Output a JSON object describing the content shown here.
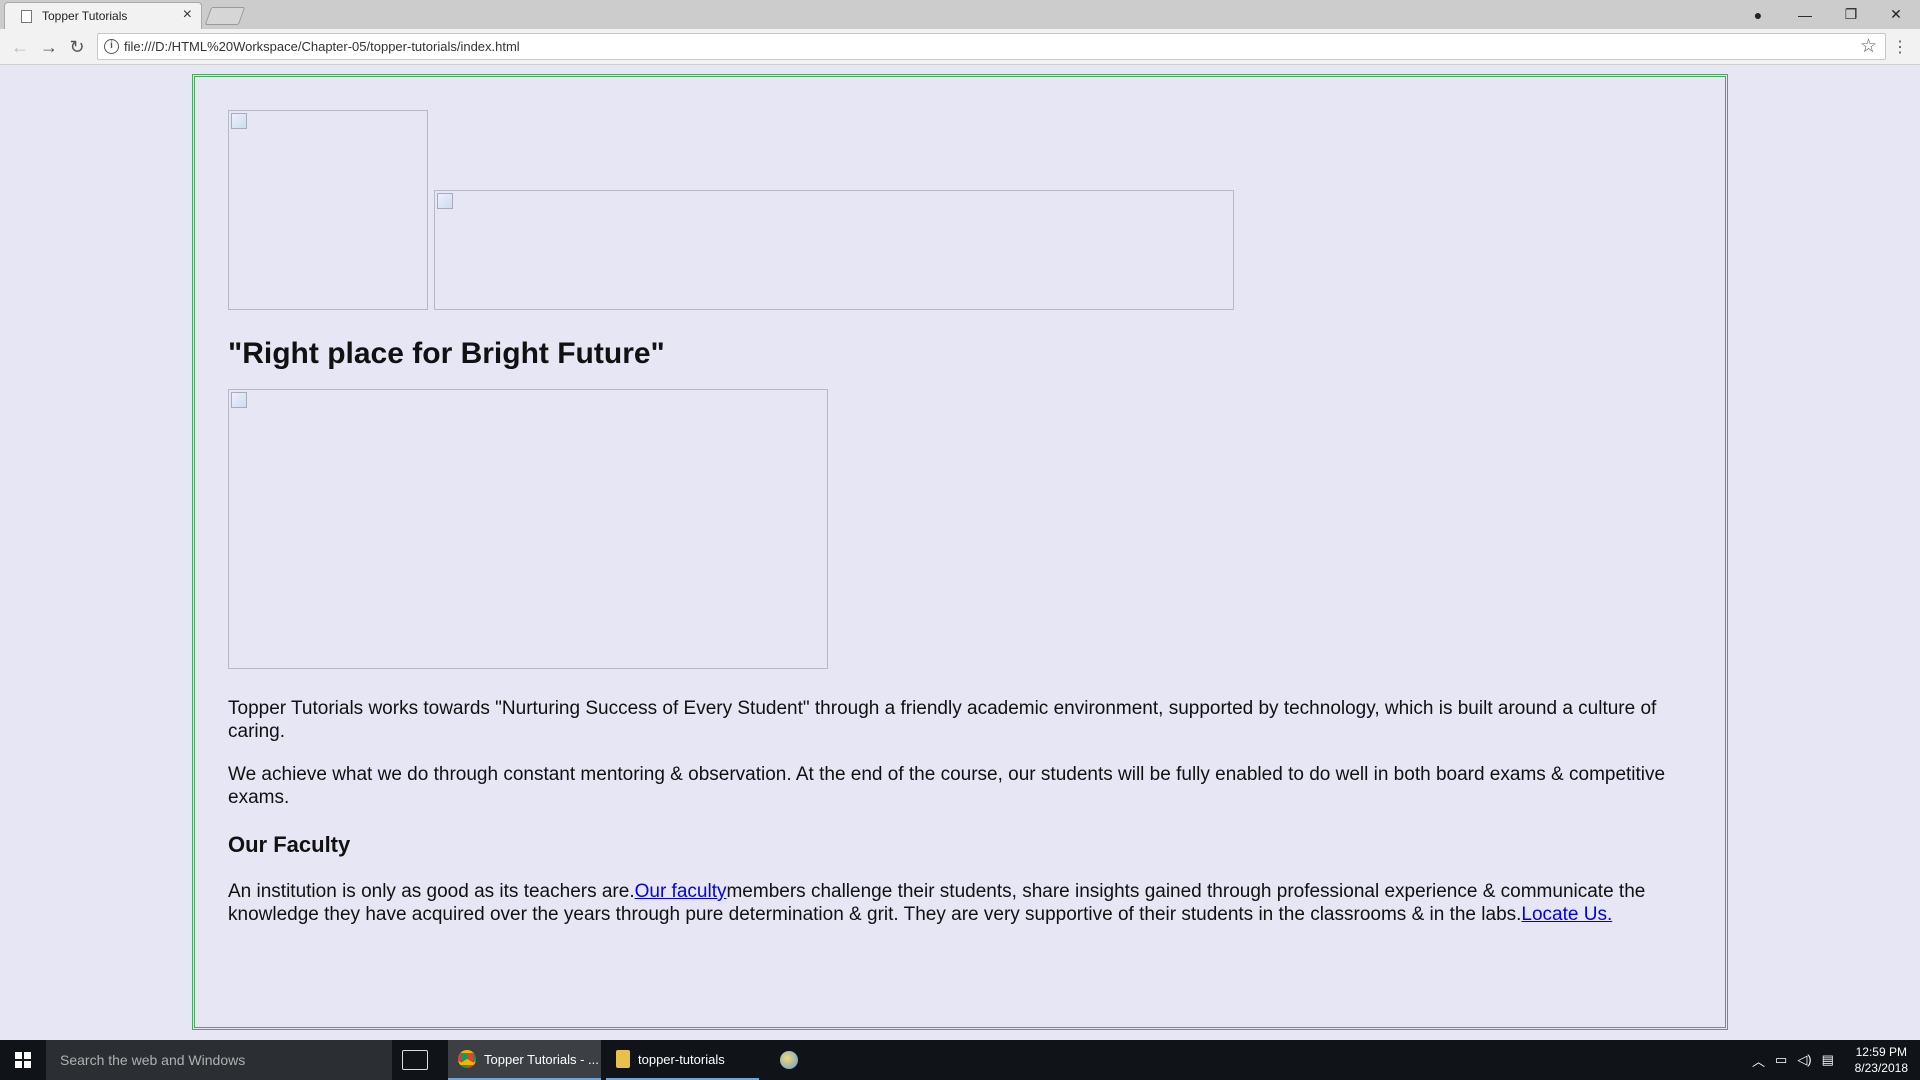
{
  "browser": {
    "tab_title": "Topper Tutorials",
    "tab_close": "×",
    "url": "file:///D:/HTML%20Workspace/Chapter-05/topper-tutorials/index.html",
    "back_glyph": "←",
    "forward_glyph": "→",
    "reload_glyph": "↻",
    "info_glyph": "i",
    "star_glyph": "☆",
    "menu_glyph": "⋮",
    "window_controls": {
      "account": "●",
      "minimize": "—",
      "restore": "❐",
      "close": "✕"
    }
  },
  "page": {
    "slogan": "\"Right place for Bright Future\"",
    "paragraph1": "Topper Tutorials works towards \"Nurturing Success of Every Student\" through a friendly academic environment, supported by technology, which is built around a culture of caring.",
    "paragraph2": "We achieve what we do through constant mentoring & observation. At the end of the course, our students will be fully enabled to do well in both board exams & competitive exams.",
    "faculty_heading": "Our Faculty",
    "faculty_text_before": "An institution is only as good as its teachers are.",
    "faculty_link": "Our faculty",
    "faculty_text_after": "members challenge their students, share insights gained through professional experience & communicate the knowledge they have acquired over the years through pure determination & grit. They are very supportive of their students in the classrooms & in the labs.",
    "locate_link": "Locate Us.",
    "colors": {
      "background": "#e6e6f5",
      "border": "#4fa862",
      "link": "#0000ee"
    }
  },
  "taskbar": {
    "search_placeholder": "Search the web and Windows",
    "items": [
      {
        "label": "Topper Tutorials - ..."
      },
      {
        "label": "topper-tutorials"
      }
    ],
    "time": "12:59 PM",
    "date": "8/23/2018"
  }
}
